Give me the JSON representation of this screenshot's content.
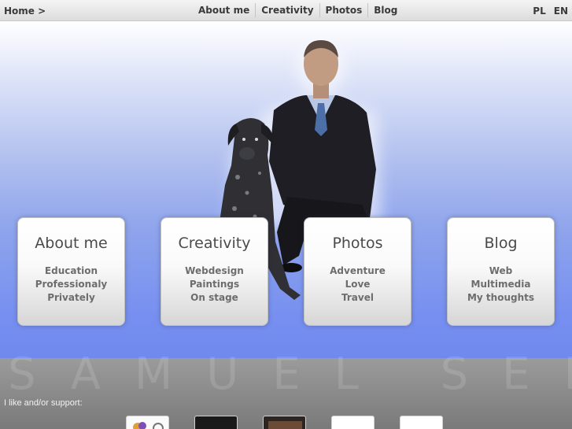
{
  "topbar": {
    "breadcrumb": "Home >",
    "nav": [
      "About me",
      "Creativity",
      "Photos",
      "Blog"
    ],
    "languages": [
      "PL",
      "EN"
    ]
  },
  "cards": [
    {
      "title": "About me",
      "links": [
        "Education",
        "Professionaly",
        "Privately"
      ]
    },
    {
      "title": "Creativity",
      "links": [
        "Webdesign",
        "Paintings",
        "On stage"
      ]
    },
    {
      "title": "Photos",
      "links": [
        "Adventure",
        "Love",
        "Travel"
      ]
    },
    {
      "title": "Blog",
      "links": [
        "Web",
        "Multimedia",
        "My thoughts"
      ]
    }
  ],
  "footer": {
    "watermark": "SAMUEL SEN",
    "support_label": "I like and/or support:"
  }
}
